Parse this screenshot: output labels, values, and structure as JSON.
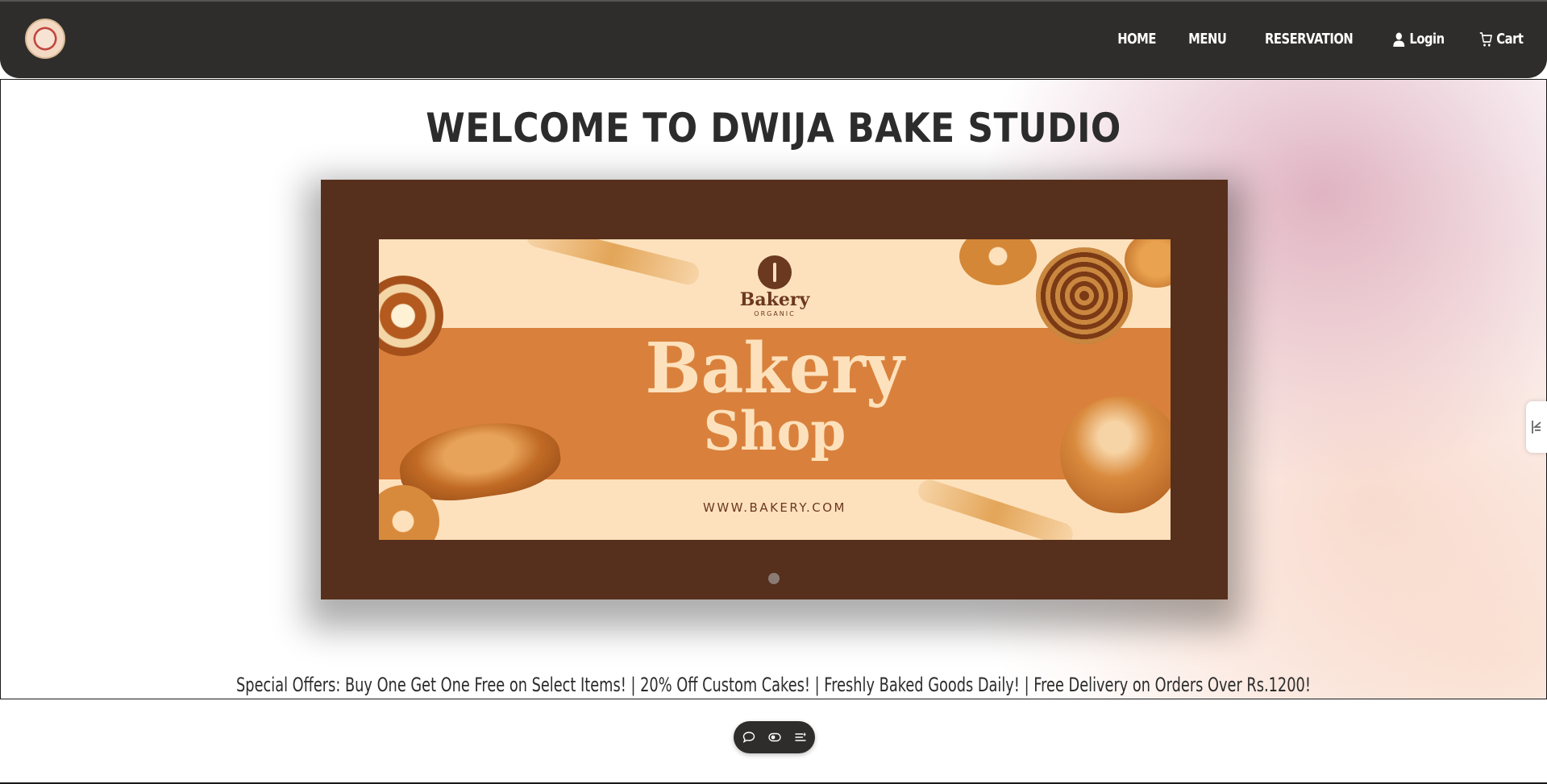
{
  "nav": {
    "logo_icon": "bakery-logo",
    "items": [
      {
        "label": "HOME"
      },
      {
        "label": "MENU"
      },
      {
        "label": "RESERVATION"
      },
      {
        "label": "Login",
        "icon": "user-icon"
      },
      {
        "label": "Cart",
        "icon": "cart-icon"
      }
    ]
  },
  "hero": {
    "title": "WELCOME TO DWIJA BAKE STUDIO",
    "banner": {
      "brand_name": "Bakery",
      "brand_sub": "ORGANIC",
      "title_line1": "Bakery",
      "title_line2": "Shop",
      "url": "WWW.BAKERY.COM"
    },
    "carousel_slide": 1,
    "carousel_total": 1
  },
  "offers_text": "Special Offers: Buy One Get One Free on Select Items! | 20% Off Custom Cakes! | Freshly Baked Goods Daily! | Free Delivery on Orders Over Rs.1200!",
  "toolbar": {
    "buttons": [
      "comment-icon",
      "toggle-icon",
      "menu-list-icon"
    ]
  },
  "colors": {
    "navbar": "#2e2d2b",
    "carousel_bg": "#56301d",
    "banner_cream": "#fde1bc",
    "banner_band": "#d9813c",
    "brand_brown": "#6b3820"
  }
}
